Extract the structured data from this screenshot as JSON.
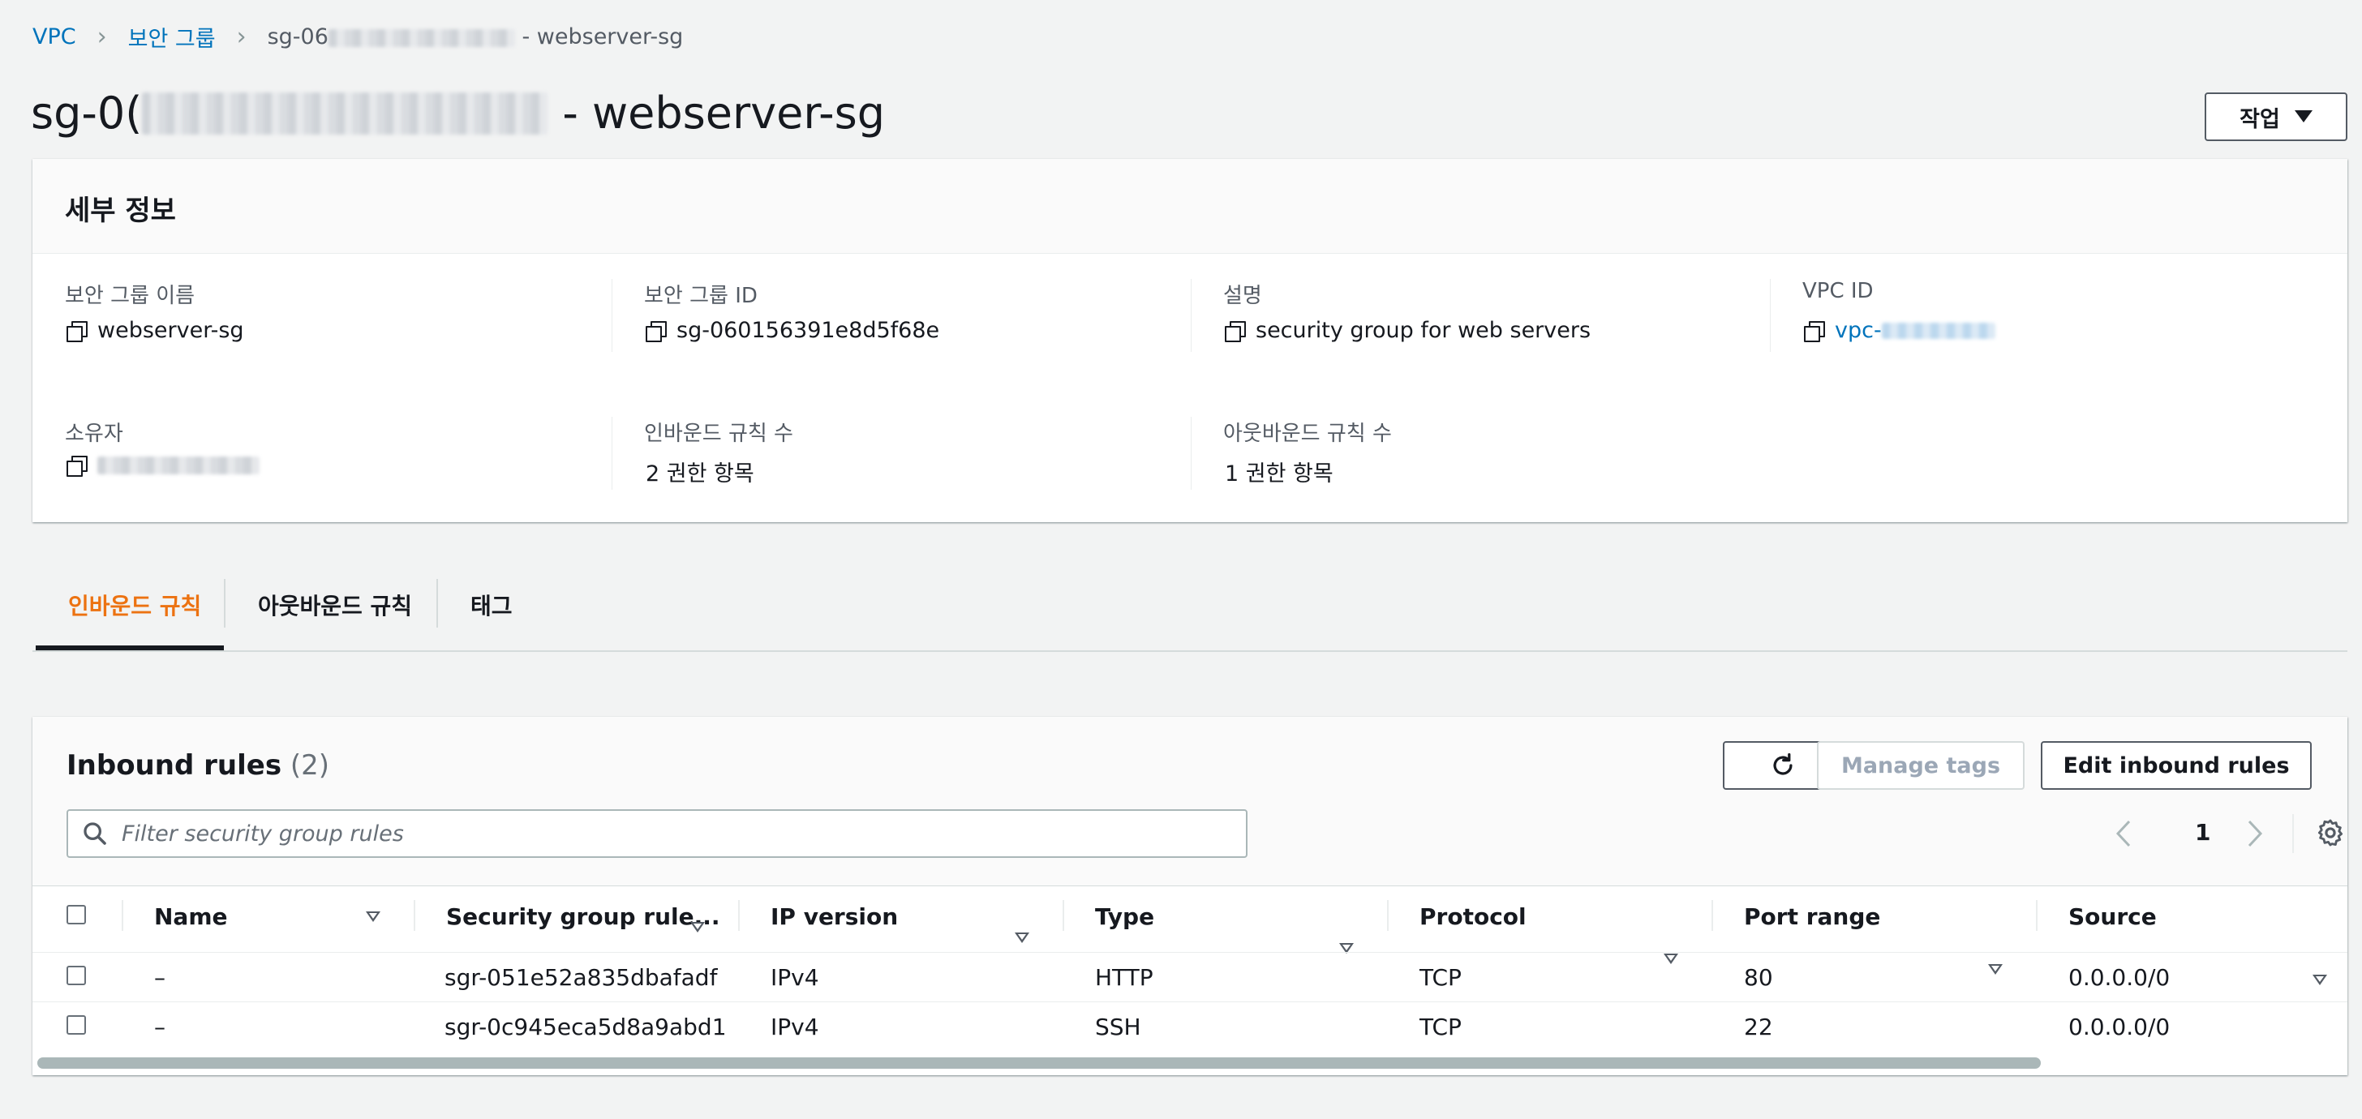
{
  "breadcrumb": {
    "root": "VPC",
    "parent": "보안 그룹",
    "current_prefix": "sg-06",
    "current_suffix": "- webserver-sg"
  },
  "page": {
    "title_prefix": "sg-0(",
    "title_suffix": "- webserver-sg",
    "actions_label": "작업"
  },
  "details": {
    "header": "세부 정보",
    "fields": {
      "sg_name_label": "보안 그룹 이름",
      "sg_name_value": "webserver-sg",
      "sg_id_label": "보안 그룹 ID",
      "sg_id_value": "sg-060156391e8d5f68e",
      "desc_label": "설명",
      "desc_value": "security group for web servers",
      "vpc_label": "VPC ID",
      "vpc_value_prefix": "vpc-",
      "owner_label": "소유자",
      "inbound_count_label": "인바운드 규칙 수",
      "inbound_count_value": "2 권한 항목",
      "outbound_count_label": "아웃바운드 규칙 수",
      "outbound_count_value": "1 권한 항목"
    }
  },
  "tabs": [
    {
      "label": "인바운드 규칙",
      "active": true
    },
    {
      "label": "아웃바운드 규칙",
      "active": false
    },
    {
      "label": "태그",
      "active": false
    }
  ],
  "rules": {
    "title": "Inbound rules",
    "count": "(2)",
    "manage_tags": "Manage tags",
    "edit_rules": "Edit inbound rules",
    "filter_placeholder": "Filter security group rules",
    "page_number": "1",
    "columns": [
      "Name",
      "Security group rule...",
      "IP version",
      "Type",
      "Protocol",
      "Port range",
      "Source"
    ],
    "rows": [
      [
        "–",
        "sgr-051e52a835dbafadf",
        "IPv4",
        "HTTP",
        "TCP",
        "80",
        "0.0.0.0/0"
      ],
      [
        "–",
        "sgr-0c945eca5d8a9abd1",
        "IPv4",
        "SSH",
        "TCP",
        "22",
        "0.0.0.0/0"
      ]
    ]
  },
  "colors": {
    "link": "#0073bb",
    "active_tab": "#ec7211",
    "background": "#f2f3f3"
  }
}
